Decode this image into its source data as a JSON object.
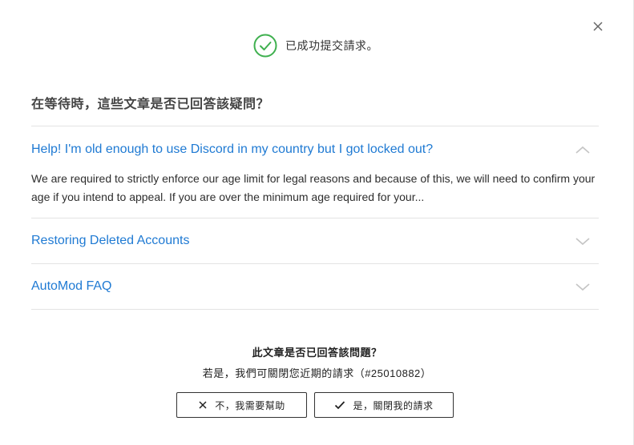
{
  "success": {
    "message": "已成功提交請求。",
    "icon": "check-circle-icon",
    "color": "#3fb04f"
  },
  "heading": "在等待時，這些文章是否已回答該疑問？",
  "faq": [
    {
      "title": "Help! I'm old enough to use Discord in my country but I got locked out?",
      "expanded": true,
      "body": "We are required to strictly enforce our age limit for legal reasons and because of this, we will need to confirm your age if you intend to appeal. If you are over the minimum age required for your..."
    },
    {
      "title": "Restoring Deleted Accounts",
      "expanded": false
    },
    {
      "title": "AutoMod FAQ",
      "expanded": false
    }
  ],
  "feedback": {
    "question": "此文章是否已回答該問題？",
    "sub": "若是，我們可關閉您近期的請求（#25010882）",
    "no_label": "不，我需要幫助",
    "yes_label": "是，關閉我的請求"
  },
  "colors": {
    "link": "#1f7ad3",
    "success": "#3fb04f"
  }
}
